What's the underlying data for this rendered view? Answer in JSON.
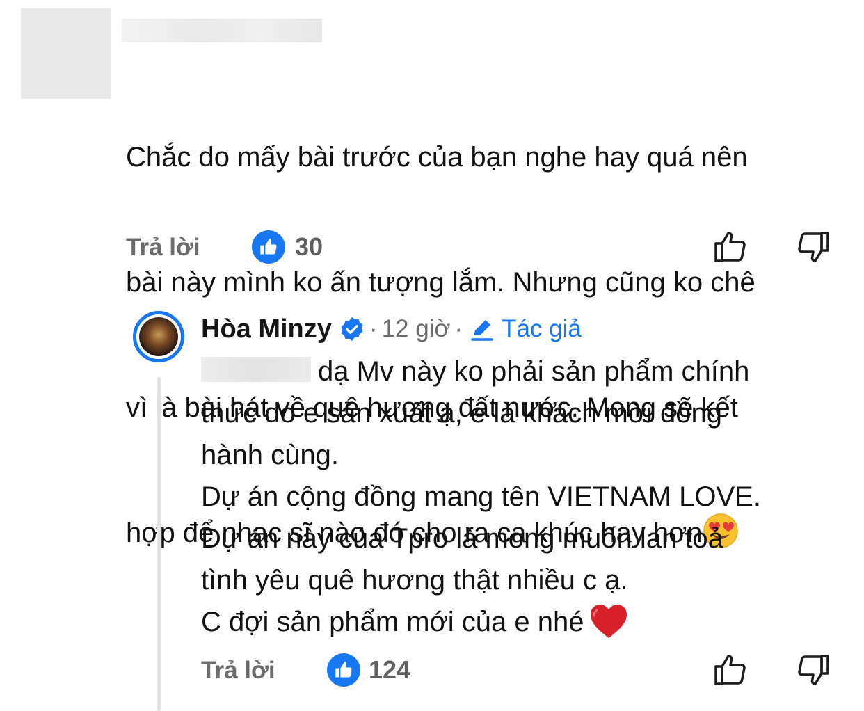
{
  "comment": {
    "lines": [
      "Chắc do mấy bài trước của bạn nghe hay quá nên",
      "bài này mình ko ấn tượng lắm. Nhưng cũng ko chê",
      "vì là bài hát về quê hương đất nước. Mong sẽ kết",
      "hợp để nhạc sĩ nào đó cho ra ca khúc hay hơn"
    ],
    "emoji": "heart-eyes-emoji",
    "reply_label": "Trả lời",
    "like_count": "30"
  },
  "reply": {
    "author": "Hòa Minzy",
    "time": "12 giờ",
    "author_tag": "Tác giả",
    "lines": [
      "dạ Mv này ko phải sản phẩm chính",
      "thức do e sản xuất ạ, e là khách mời đồng",
      "hành cùng.",
      "Dự án cộng đồng mang tên VIETNAM LOVE.",
      "Dự án này của Tpro là mong muốn lan toả",
      "tình yêu quê hương thật nhiều c ạ.",
      "C đợi sản phẩm mới của e nhé"
    ],
    "emoji": "red-heart-emoji",
    "reply_label": "Trả lời",
    "like_count": "124"
  },
  "colors": {
    "accent": "#1877f2",
    "muted": "#6b6b6b",
    "text": "#111111"
  },
  "icons": [
    "thumbs-up-icon",
    "thumbs-down-icon",
    "verified-badge-icon",
    "pencil-icon"
  ]
}
